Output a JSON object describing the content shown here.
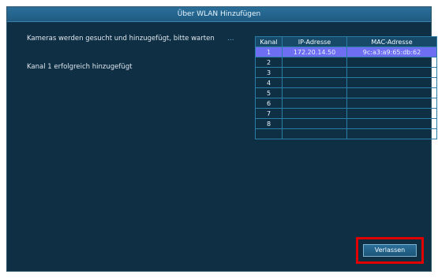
{
  "dialog": {
    "title": "Über WLAN Hinzufügen",
    "status_message": "Kameras werden gesucht und hinzugefügt, bitte warten",
    "progress_dots": "...",
    "result_message": "Kanal 1 erfolgreich hinzugefügt",
    "exit_button": "Verlassen"
  },
  "table": {
    "headers": [
      "Kanal",
      "IP-Adresse",
      "MAC-Adresse"
    ],
    "rows": [
      {
        "kanal": "1",
        "ip": "172.20.14.50",
        "mac": "9c:a3:a9:65:db:62"
      },
      {
        "kanal": "2",
        "ip": "",
        "mac": ""
      },
      {
        "kanal": "3",
        "ip": "",
        "mac": ""
      },
      {
        "kanal": "4",
        "ip": "",
        "mac": ""
      },
      {
        "kanal": "5",
        "ip": "",
        "mac": ""
      },
      {
        "kanal": "6",
        "ip": "",
        "mac": ""
      },
      {
        "kanal": "7",
        "ip": "",
        "mac": ""
      },
      {
        "kanal": "8",
        "ip": "",
        "mac": ""
      },
      {
        "kanal": "",
        "ip": "",
        "mac": ""
      }
    ]
  }
}
